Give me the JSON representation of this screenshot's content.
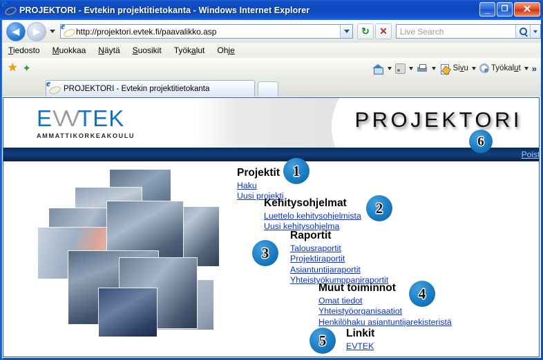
{
  "window": {
    "title": "PROJEKTORI - Evtekin projektitietokanta - Windows Internet Explorer",
    "minimize_label": "_",
    "maximize_label": "❐",
    "close_label": "✕"
  },
  "address_bar": {
    "url": "http://projektori.evtek.fi/paavalikko.asp",
    "back_label": "◀",
    "forward_label": "▶",
    "refresh_label": "↻",
    "stop_label": "✕",
    "search_placeholder": "Live Search"
  },
  "menubar": {
    "items": [
      {
        "label": "Tiedosto",
        "accel": "T"
      },
      {
        "label": "Muokkaa",
        "accel": "M"
      },
      {
        "label": "Näytä",
        "accel": "N"
      },
      {
        "label": "Suosikit",
        "accel": "S"
      },
      {
        "label": "Työkalut",
        "accel": "a"
      },
      {
        "label": "Ohje",
        "accel": "e"
      }
    ]
  },
  "tabs": {
    "items": [
      {
        "label": "PROJEKTORI - Evtekin projektitietokanta"
      }
    ],
    "new_tab_label": ""
  },
  "command_bar": {
    "home_label": "",
    "feeds_label": "",
    "print_label": "",
    "page_label": "Sivu",
    "tools_label": "Työkalut",
    "overflow_label": "»"
  },
  "site": {
    "logo_primary": "E",
    "logo_ligature": "VV",
    "logo_rest": "TEK",
    "logo_subtitle": "AMMATTIKORKEAKOULU",
    "title": "PROJEKTORI",
    "logout_link": "Poistu"
  },
  "nav": {
    "groups": [
      {
        "heading": "Projektit",
        "badge": "1",
        "links": [
          "Haku",
          "Uusi projekti"
        ]
      },
      {
        "heading": "Kehitysohjelmat",
        "badge": "2",
        "links": [
          "Luettelo kehitysohjelmista",
          "Uusi kehitysohjelma"
        ]
      },
      {
        "heading": "Raportit",
        "badge": "3",
        "links": [
          "Talousraportit",
          "Projektiraportit",
          "Asiantuntijaraportit",
          "Yhteistyökumppaniraportit"
        ]
      },
      {
        "heading": "Muut toiminnot",
        "badge": "4",
        "links": [
          "Omat tiedot",
          "Yhteistyöorganisaatiot",
          "Henkilöhaku asiantuntijarekisteristä"
        ]
      },
      {
        "heading": "Linkit",
        "badge": "5",
        "links": [
          "EVTEK"
        ]
      }
    ],
    "logout_badge": "6"
  },
  "colors": {
    "badge_blue": "#1b7fc4",
    "link_blue": "#0a2fd6",
    "navy_bar": "#123f7e",
    "logo_blue": "#1571c1",
    "logo_gray": "#9b9b9b",
    "titlebar_blue": "#0d47bd"
  }
}
